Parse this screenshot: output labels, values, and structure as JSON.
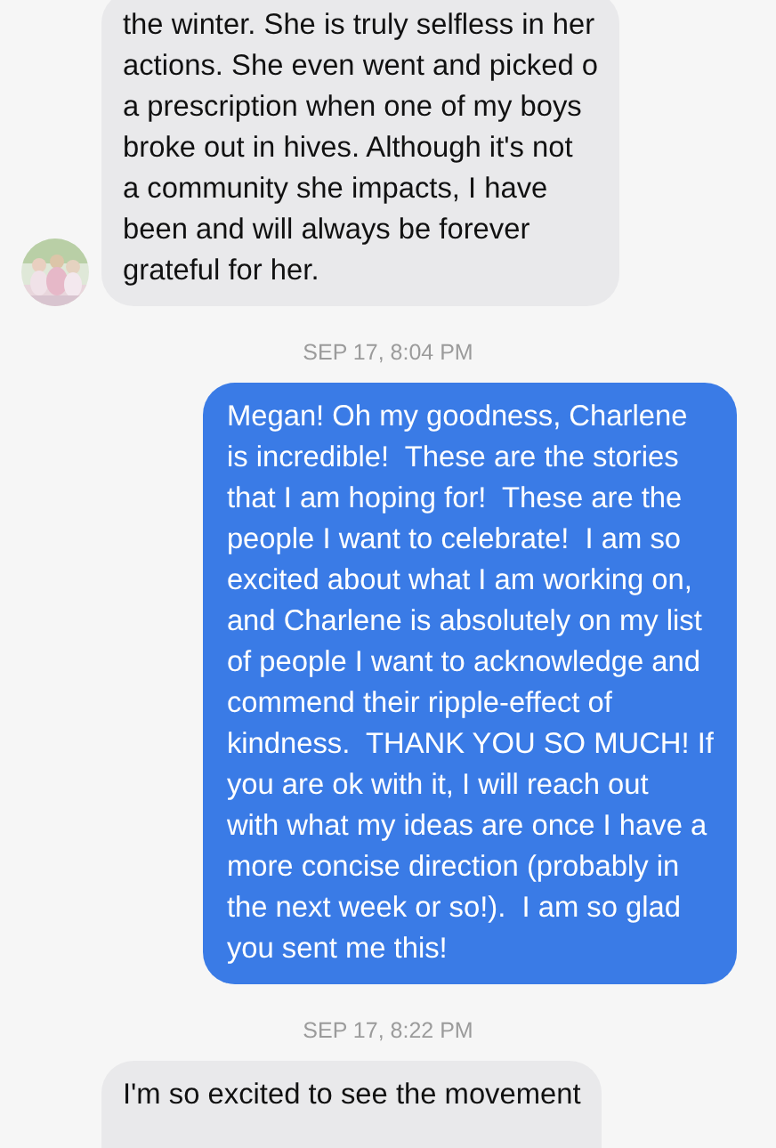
{
  "conversation": [
    {
      "kind": "incoming",
      "show_avatar": true,
      "text": "the winter. She is truly selfless in her\nactions. She even went and picked o\na prescription when one of my boys\nbroke out in hives. Although it's not\na community she impacts, I have\nbeen and will always be forever\ngrateful for her."
    },
    {
      "kind": "timestamp",
      "text": "SEP 17, 8:04 PM"
    },
    {
      "kind": "outgoing",
      "text": "Megan! Oh my goodness, Charlene\nis incredible!  These are the stories\nthat I am hoping for!  These are the\npeople I want to celebrate!  I am so\nexcited about what I am working on,\nand Charlene is absolutely on my list\nof people I want to acknowledge and\ncommend their ripple-effect of\nkindness.  THANK YOU SO MUCH! If\nyou are ok with it, I will reach out\nwith what my ideas are once I have a\nmore concise direction (probably in\nthe next week or so!).  I am so glad\nyou sent me this!"
    },
    {
      "kind": "timestamp",
      "text": "SEP 17, 8:22 PM"
    },
    {
      "kind": "incoming",
      "show_avatar": false,
      "text": "I'm so excited to see the movement"
    }
  ]
}
